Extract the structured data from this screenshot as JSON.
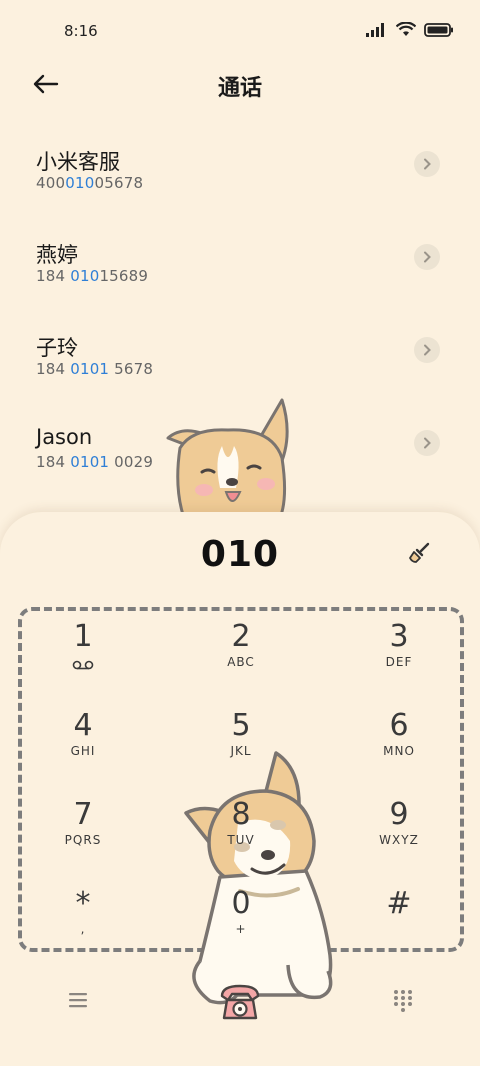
{
  "status_bar": {
    "time": "8:16"
  },
  "header": {
    "title": "通话"
  },
  "contacts": [
    {
      "name": "小米客服",
      "number_pre": "400",
      "number_hl": "010",
      "number_post": "05678"
    },
    {
      "name": "燕婷",
      "number_pre": "184 ",
      "number_hl": "010",
      "number_post": "15689"
    },
    {
      "name": "子玲",
      "number_pre": "184 ",
      "number_hl": "0101",
      "number_post": " 5678"
    },
    {
      "name": "Jason",
      "number_pre": "184 ",
      "number_hl": "0101",
      "number_post": " 0029"
    }
  ],
  "dialer": {
    "number": "010"
  },
  "keypad": [
    {
      "digit": "1",
      "letters": "voicemail-icon"
    },
    {
      "digit": "2",
      "letters": "ABC"
    },
    {
      "digit": "3",
      "letters": "DEF"
    },
    {
      "digit": "4",
      "letters": "GHI"
    },
    {
      "digit": "5",
      "letters": "JKL"
    },
    {
      "digit": "6",
      "letters": "MNO"
    },
    {
      "digit": "7",
      "letters": "PQRS"
    },
    {
      "digit": "8",
      "letters": "TUV"
    },
    {
      "digit": "9",
      "letters": "WXYZ"
    },
    {
      "digit": "*",
      "letters": ","
    },
    {
      "digit": "0",
      "letters": "+"
    },
    {
      "digit": "#",
      "letters": ""
    }
  ],
  "colors": {
    "background": "#FCF1DF",
    "highlight": "#2f7fd6",
    "chevron_bg": "#ECE3D2",
    "frame": "#7d7d7d"
  },
  "icons": [
    "back-arrow-icon",
    "chevron-right-icon",
    "brush-clear-icon",
    "menu-icon",
    "phone-call-icon",
    "keypad-icon",
    "signal-icon",
    "wifi-icon",
    "battery-icon"
  ]
}
